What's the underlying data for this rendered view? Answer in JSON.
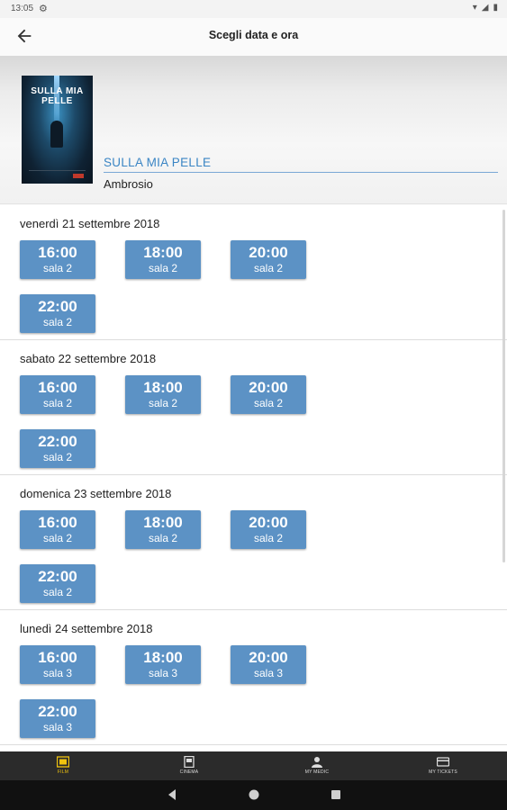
{
  "status_bar": {
    "time": "13:05"
  },
  "app_bar": {
    "title": "Scegli data e ora"
  },
  "movie": {
    "poster_text": "SULLA MIA PELLE",
    "title": "SULLA MIA PELLE",
    "director": "Ambrosio"
  },
  "days": [
    {
      "label": "venerdì 21 settembre 2018",
      "slots": [
        {
          "time": "16:00",
          "sala": "sala 2"
        },
        {
          "time": "18:00",
          "sala": "sala 2"
        },
        {
          "time": "20:00",
          "sala": "sala 2"
        },
        {
          "time": "22:00",
          "sala": "sala 2"
        }
      ]
    },
    {
      "label": "sabato 22 settembre 2018",
      "slots": [
        {
          "time": "16:00",
          "sala": "sala 2"
        },
        {
          "time": "18:00",
          "sala": "sala 2"
        },
        {
          "time": "20:00",
          "sala": "sala 2"
        },
        {
          "time": "22:00",
          "sala": "sala 2"
        }
      ]
    },
    {
      "label": "domenica 23 settembre 2018",
      "slots": [
        {
          "time": "16:00",
          "sala": "sala 2"
        },
        {
          "time": "18:00",
          "sala": "sala 2"
        },
        {
          "time": "20:00",
          "sala": "sala 2"
        },
        {
          "time": "22:00",
          "sala": "sala 2"
        }
      ]
    },
    {
      "label": "lunedì 24 settembre 2018",
      "slots": [
        {
          "time": "16:00",
          "sala": "sala 3"
        },
        {
          "time": "18:00",
          "sala": "sala 3"
        },
        {
          "time": "20:00",
          "sala": "sala 3"
        },
        {
          "time": "22:00",
          "sala": "sala 3"
        }
      ]
    }
  ],
  "bottom_nav": [
    {
      "label": "FILM",
      "icon": "film-icon",
      "active": true
    },
    {
      "label": "CINEMA",
      "icon": "cinema-icon",
      "active": false
    },
    {
      "label": "MY MEDIC",
      "icon": "user-icon",
      "active": false
    },
    {
      "label": "MY TICKETS",
      "icon": "ticket-icon",
      "active": false
    }
  ],
  "colors": {
    "accent": "#5c92c5",
    "title_blue": "#3a85c4",
    "nav_active": "#f1c40f",
    "nav_bg": "#2b2b2b"
  }
}
